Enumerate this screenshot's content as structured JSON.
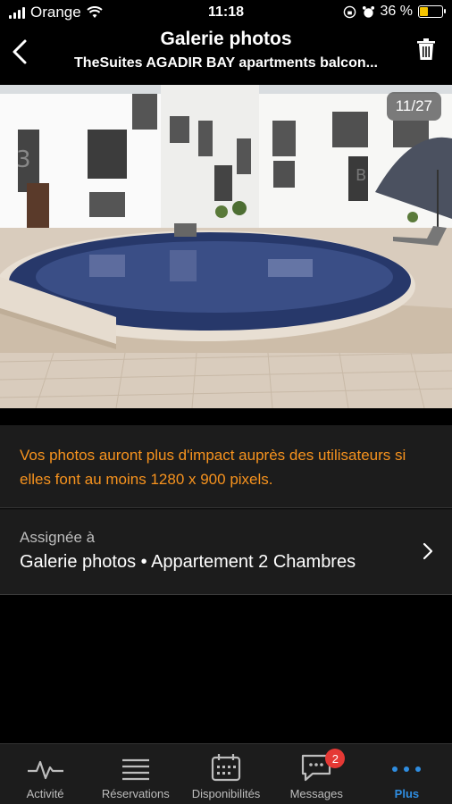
{
  "status_bar": {
    "carrier": "Orange",
    "time": "11:18",
    "battery_percent": "36 %",
    "battery_level": 0.36
  },
  "header": {
    "title": "Galerie photos",
    "subtitle": "TheSuites AGADIR BAY apartments balcon..."
  },
  "photo": {
    "counter": "11/27"
  },
  "notice": {
    "text": "Vos photos auront plus d'impact auprès des utilisateurs si elles font au moins 1280 x 900 pixels."
  },
  "assigned": {
    "label": "Assignée à",
    "value": "Galerie photos • Appartement 2 Chambres"
  },
  "tabs": [
    {
      "label": "Activité",
      "icon": "activity-icon"
    },
    {
      "label": "Réservations",
      "icon": "list-icon"
    },
    {
      "label": "Disponibilités",
      "icon": "calendar-icon"
    },
    {
      "label": "Messages",
      "icon": "message-icon",
      "badge": "2"
    },
    {
      "label": "Plus",
      "icon": "more-icon",
      "active": true
    }
  ],
  "colors": {
    "accent": "#2f8de0",
    "notice": "#f7931e",
    "badge": "#e53935"
  }
}
